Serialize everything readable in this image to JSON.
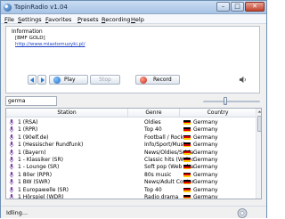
{
  "window": {
    "title": "TapinRadio v1.04",
    "minimize": "–",
    "maximize": "□",
    "close": "✕"
  },
  "menu": [
    {
      "label": "File",
      "key": "F",
      "rest": "ile"
    },
    {
      "label": "Settings",
      "key": "S",
      "rest": "ettings"
    },
    {
      "label": "Favorites",
      "key": "F",
      "rest": "avorites"
    },
    {
      "label": "Presets",
      "key": "P",
      "rest": "resets"
    },
    {
      "label": "Recording",
      "key": "R",
      "rest": "ecording"
    },
    {
      "label": "Help",
      "key": "H",
      "rest": "elp"
    }
  ],
  "info": {
    "heading": "Information",
    "now_playing": "[BMF GOLD]",
    "link": "http://www.miastomuzyki.pl/"
  },
  "controls": {
    "play": "Play",
    "stop": "Stop",
    "record": "Record"
  },
  "search": {
    "value": "germa"
  },
  "volume": {
    "level": 0.38
  },
  "table": {
    "columns": [
      "Station",
      "Genre",
      "Country"
    ],
    "rows": [
      {
        "station": "1 (RSA)",
        "genre": "Oldies",
        "country": "Germany"
      },
      {
        "station": "1 (RPR)",
        "genre": "Top 40",
        "country": "Germany"
      },
      {
        "station": "1 (90elf.de)",
        "genre": "Football / Rock",
        "country": "Germany"
      },
      {
        "station": "1 (Hessischer Rundfunk)",
        "genre": "Info/Sport/Music",
        "country": "Germany"
      },
      {
        "station": "1 (Bayern)",
        "genre": "News/Oldies/Schlager",
        "country": "Germany"
      },
      {
        "station": "1 - Klassiker (SR)",
        "genre": "Classic hits (Web channel)",
        "country": "Germany"
      },
      {
        "station": "1 - Lounge (SR)",
        "genre": "Soft pop (Web channel)",
        "country": "Germany"
      },
      {
        "station": "1 80er (RPR)",
        "genre": "80s music",
        "country": "Germany"
      },
      {
        "station": "1 BW (SWR)",
        "genre": "News/Adult Contempor...",
        "country": "Germany"
      },
      {
        "station": "1 Europawelle (SR)",
        "genre": "Top 40",
        "country": "Germany"
      },
      {
        "station": "1 Hörspiel (WDR)",
        "genre": "Radio drama",
        "country": "Germany"
      }
    ]
  },
  "status": {
    "text": "Idling..."
  },
  "colors": {
    "accent": "#1b3fc4",
    "play": "#2a7bd4",
    "record": "#d63b2a",
    "mic": "#7a3fa3"
  },
  "flag_colors": [
    "#000000",
    "#dd0000",
    "#ffce00"
  ]
}
